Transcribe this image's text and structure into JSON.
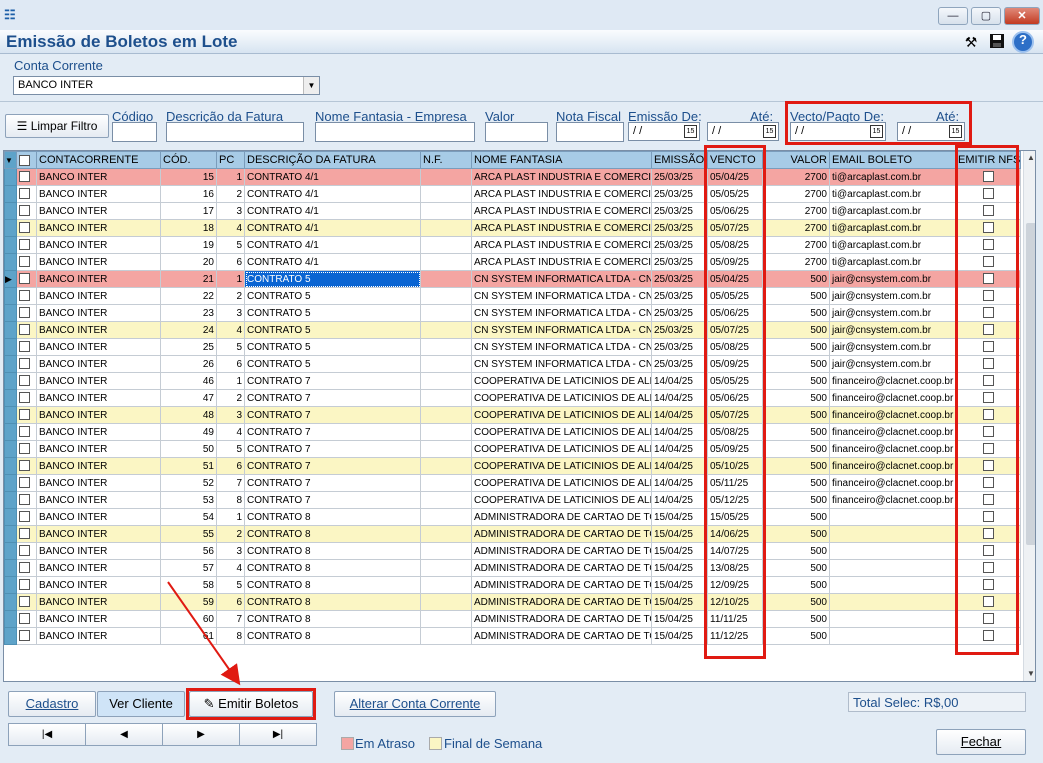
{
  "window": {
    "app_icon": "app-logo-icon",
    "title": "Emissão de Boletos em Lote",
    "controls": {
      "minimize": "—",
      "maximize": "▢",
      "close": "✕"
    }
  },
  "header_icons": [
    "tools-icon",
    "save-icon",
    "help-icon"
  ],
  "account": {
    "label": "Conta Corrente",
    "value": "BANCO INTER"
  },
  "filters": {
    "clear_button": "Limpar Filtro",
    "codigo_label": "Código",
    "descricao_label": "Descrição da Fatura",
    "fantasia_label": "Nome Fantasia - Empresa",
    "valor_label": "Valor",
    "nota_label": "Nota Fiscal",
    "emissao_label": "Emissão De:",
    "emissao_ate_label": "Até:",
    "vecto_label": "Vecto/Pagto De:",
    "vecto_ate_label": "Até:",
    "emissao_de": "/ /",
    "emissao_ate": "/ /",
    "vecto_de": "/ /",
    "vecto_ate": "/ /",
    "cal_glyph": "15"
  },
  "grid": {
    "columns": [
      "CONTACORRENTE",
      "CÓD.",
      "PC",
      "DESCRIÇÃO DA FATURA",
      "N.F.",
      "NOME FANTASIA",
      "EMISSÃO",
      "VENCTO",
      "VALOR",
      "EMAIL BOLETO",
      "EMITIR NFS"
    ],
    "current_row_marker": "▶",
    "rows": [
      {
        "conta": "BANCO INTER",
        "cod": "15",
        "pc": "1",
        "desc": "CONTRATO 4/1",
        "nf": "",
        "fantasia": "ARCA PLAST INDUSTRIA E COMERCIO",
        "emissao": "25/03/25",
        "vencto": "05/04/25",
        "valor": "2700",
        "email": "ti@arcaplast.com.br",
        "status": "late"
      },
      {
        "conta": "BANCO INTER",
        "cod": "16",
        "pc": "2",
        "desc": "CONTRATO 4/1",
        "nf": "",
        "fantasia": "ARCA PLAST INDUSTRIA E COMERCIO",
        "emissao": "25/03/25",
        "vencto": "05/05/25",
        "valor": "2700",
        "email": "ti@arcaplast.com.br",
        "status": "normal"
      },
      {
        "conta": "BANCO INTER",
        "cod": "17",
        "pc": "3",
        "desc": "CONTRATO 4/1",
        "nf": "",
        "fantasia": "ARCA PLAST INDUSTRIA E COMERCIO",
        "emissao": "25/03/25",
        "vencto": "05/06/25",
        "valor": "2700",
        "email": "ti@arcaplast.com.br",
        "status": "normal"
      },
      {
        "conta": "BANCO INTER",
        "cod": "18",
        "pc": "4",
        "desc": "CONTRATO 4/1",
        "nf": "",
        "fantasia": "ARCA PLAST INDUSTRIA E COMERCIO",
        "emissao": "25/03/25",
        "vencto": "05/07/25",
        "valor": "2700",
        "email": "ti@arcaplast.com.br",
        "status": "weekend"
      },
      {
        "conta": "BANCO INTER",
        "cod": "19",
        "pc": "5",
        "desc": "CONTRATO 4/1",
        "nf": "",
        "fantasia": "ARCA PLAST INDUSTRIA E COMERCIO",
        "emissao": "25/03/25",
        "vencto": "05/08/25",
        "valor": "2700",
        "email": "ti@arcaplast.com.br",
        "status": "normal"
      },
      {
        "conta": "BANCO INTER",
        "cod": "20",
        "pc": "6",
        "desc": "CONTRATO 4/1",
        "nf": "",
        "fantasia": "ARCA PLAST INDUSTRIA E COMERCIO",
        "emissao": "25/03/25",
        "vencto": "05/09/25",
        "valor": "2700",
        "email": "ti@arcaplast.com.br",
        "status": "normal"
      },
      {
        "conta": "BANCO INTER",
        "cod": "21",
        "pc": "1",
        "desc": "CONTRATO 5",
        "nf": "",
        "fantasia": "CN SYSTEM INFORMATICA LTDA - CN S",
        "emissao": "25/03/25",
        "vencto": "05/04/25",
        "valor": "500",
        "email": "jair@cnsystem.com.br",
        "status": "late",
        "current": true
      },
      {
        "conta": "BANCO INTER",
        "cod": "22",
        "pc": "2",
        "desc": "CONTRATO 5",
        "nf": "",
        "fantasia": "CN SYSTEM INFORMATICA LTDA - CN S",
        "emissao": "25/03/25",
        "vencto": "05/05/25",
        "valor": "500",
        "email": "jair@cnsystem.com.br",
        "status": "normal"
      },
      {
        "conta": "BANCO INTER",
        "cod": "23",
        "pc": "3",
        "desc": "CONTRATO 5",
        "nf": "",
        "fantasia": "CN SYSTEM INFORMATICA LTDA - CN S",
        "emissao": "25/03/25",
        "vencto": "05/06/25",
        "valor": "500",
        "email": "jair@cnsystem.com.br",
        "status": "normal"
      },
      {
        "conta": "BANCO INTER",
        "cod": "24",
        "pc": "4",
        "desc": "CONTRATO 5",
        "nf": "",
        "fantasia": "CN SYSTEM INFORMATICA LTDA - CN S",
        "emissao": "25/03/25",
        "vencto": "05/07/25",
        "valor": "500",
        "email": "jair@cnsystem.com.br",
        "status": "weekend"
      },
      {
        "conta": "BANCO INTER",
        "cod": "25",
        "pc": "5",
        "desc": "CONTRATO 5",
        "nf": "",
        "fantasia": "CN SYSTEM INFORMATICA LTDA - CN S",
        "emissao": "25/03/25",
        "vencto": "05/08/25",
        "valor": "500",
        "email": "jair@cnsystem.com.br",
        "status": "normal"
      },
      {
        "conta": "BANCO INTER",
        "cod": "26",
        "pc": "6",
        "desc": "CONTRATO 5",
        "nf": "",
        "fantasia": "CN SYSTEM INFORMATICA LTDA - CN S",
        "emissao": "25/03/25",
        "vencto": "05/09/25",
        "valor": "500",
        "email": "jair@cnsystem.com.br",
        "status": "normal"
      },
      {
        "conta": "BANCO INTER",
        "cod": "46",
        "pc": "1",
        "desc": "CONTRATO 7",
        "nf": "",
        "fantasia": "COOPERATIVA DE LATICINIOS DE ALFR",
        "emissao": "14/04/25",
        "vencto": "05/05/25",
        "valor": "500",
        "email": "financeiro@clacnet.coop.br",
        "status": "normal"
      },
      {
        "conta": "BANCO INTER",
        "cod": "47",
        "pc": "2",
        "desc": "CONTRATO 7",
        "nf": "",
        "fantasia": "COOPERATIVA DE LATICINIOS DE ALFR",
        "emissao": "14/04/25",
        "vencto": "05/06/25",
        "valor": "500",
        "email": "financeiro@clacnet.coop.br",
        "status": "normal"
      },
      {
        "conta": "BANCO INTER",
        "cod": "48",
        "pc": "3",
        "desc": "CONTRATO 7",
        "nf": "",
        "fantasia": "COOPERATIVA DE LATICINIOS DE ALFR",
        "emissao": "14/04/25",
        "vencto": "05/07/25",
        "valor": "500",
        "email": "financeiro@clacnet.coop.br",
        "status": "weekend"
      },
      {
        "conta": "BANCO INTER",
        "cod": "49",
        "pc": "4",
        "desc": "CONTRATO 7",
        "nf": "",
        "fantasia": "COOPERATIVA DE LATICINIOS DE ALFR",
        "emissao": "14/04/25",
        "vencto": "05/08/25",
        "valor": "500",
        "email": "financeiro@clacnet.coop.br",
        "status": "normal"
      },
      {
        "conta": "BANCO INTER",
        "cod": "50",
        "pc": "5",
        "desc": "CONTRATO 7",
        "nf": "",
        "fantasia": "COOPERATIVA DE LATICINIOS DE ALFR",
        "emissao": "14/04/25",
        "vencto": "05/09/25",
        "valor": "500",
        "email": "financeiro@clacnet.coop.br",
        "status": "normal"
      },
      {
        "conta": "BANCO INTER",
        "cod": "51",
        "pc": "6",
        "desc": "CONTRATO 7",
        "nf": "",
        "fantasia": "COOPERATIVA DE LATICINIOS DE ALFR",
        "emissao": "14/04/25",
        "vencto": "05/10/25",
        "valor": "500",
        "email": "financeiro@clacnet.coop.br",
        "status": "weekend"
      },
      {
        "conta": "BANCO INTER",
        "cod": "52",
        "pc": "7",
        "desc": "CONTRATO 7",
        "nf": "",
        "fantasia": "COOPERATIVA DE LATICINIOS DE ALFR",
        "emissao": "14/04/25",
        "vencto": "05/11/25",
        "valor": "500",
        "email": "financeiro@clacnet.coop.br",
        "status": "normal"
      },
      {
        "conta": "BANCO INTER",
        "cod": "53",
        "pc": "8",
        "desc": "CONTRATO 7",
        "nf": "",
        "fantasia": "COOPERATIVA DE LATICINIOS DE ALFR",
        "emissao": "14/04/25",
        "vencto": "05/12/25",
        "valor": "500",
        "email": "financeiro@clacnet.coop.br",
        "status": "normal"
      },
      {
        "conta": "BANCO INTER",
        "cod": "54",
        "pc": "1",
        "desc": "CONTRATO 8",
        "nf": "",
        "fantasia": "ADMINISTRADORA DE CARTAO DE TOD",
        "emissao": "15/04/25",
        "vencto": "15/05/25",
        "valor": "500",
        "email": "",
        "status": "normal"
      },
      {
        "conta": "BANCO INTER",
        "cod": "55",
        "pc": "2",
        "desc": "CONTRATO 8",
        "nf": "",
        "fantasia": "ADMINISTRADORA DE CARTAO DE TOD",
        "emissao": "15/04/25",
        "vencto": "14/06/25",
        "valor": "500",
        "email": "",
        "status": "weekend"
      },
      {
        "conta": "BANCO INTER",
        "cod": "56",
        "pc": "3",
        "desc": "CONTRATO 8",
        "nf": "",
        "fantasia": "ADMINISTRADORA DE CARTAO DE TOD",
        "emissao": "15/04/25",
        "vencto": "14/07/25",
        "valor": "500",
        "email": "",
        "status": "normal"
      },
      {
        "conta": "BANCO INTER",
        "cod": "57",
        "pc": "4",
        "desc": "CONTRATO 8",
        "nf": "",
        "fantasia": "ADMINISTRADORA DE CARTAO DE TOD",
        "emissao": "15/04/25",
        "vencto": "13/08/25",
        "valor": "500",
        "email": "",
        "status": "normal"
      },
      {
        "conta": "BANCO INTER",
        "cod": "58",
        "pc": "5",
        "desc": "CONTRATO 8",
        "nf": "",
        "fantasia": "ADMINISTRADORA DE CARTAO DE TOD",
        "emissao": "15/04/25",
        "vencto": "12/09/25",
        "valor": "500",
        "email": "",
        "status": "normal"
      },
      {
        "conta": "BANCO INTER",
        "cod": "59",
        "pc": "6",
        "desc": "CONTRATO 8",
        "nf": "",
        "fantasia": "ADMINISTRADORA DE CARTAO DE TOD",
        "emissao": "15/04/25",
        "vencto": "12/10/25",
        "valor": "500",
        "email": "",
        "status": "weekend"
      },
      {
        "conta": "BANCO INTER",
        "cod": "60",
        "pc": "7",
        "desc": "CONTRATO 8",
        "nf": "",
        "fantasia": "ADMINISTRADORA DE CARTAO DE TOD",
        "emissao": "15/04/25",
        "vencto": "11/11/25",
        "valor": "500",
        "email": "",
        "status": "normal"
      },
      {
        "conta": "BANCO INTER",
        "cod": "61",
        "pc": "8",
        "desc": "CONTRATO 8",
        "nf": "",
        "fantasia": "ADMINISTRADORA DE CARTAO DE TOD",
        "emissao": "15/04/25",
        "vencto": "11/12/25",
        "valor": "500",
        "email": "",
        "status": "normal"
      }
    ]
  },
  "buttons": {
    "cadastro": "Cadastro",
    "ver_cliente": "Ver Cliente",
    "emitir_boletos": "Emitir Boletos",
    "alterar_conta": "Alterar Conta Corrente",
    "fechar": "Fechar",
    "nav_first": "|◀",
    "nav_prev": "◀",
    "nav_next": "▶",
    "nav_last": "▶|"
  },
  "total": "Total Selec: R$,00",
  "legend": {
    "late_label": "Em Atraso",
    "weekend_label": "Final de Semana"
  },
  "colors": {
    "late_row": "#f4a5a2",
    "weekend_row": "#fbf6c4",
    "header_blue": "#1d4f8c",
    "highlight_red": "#e01a12"
  }
}
